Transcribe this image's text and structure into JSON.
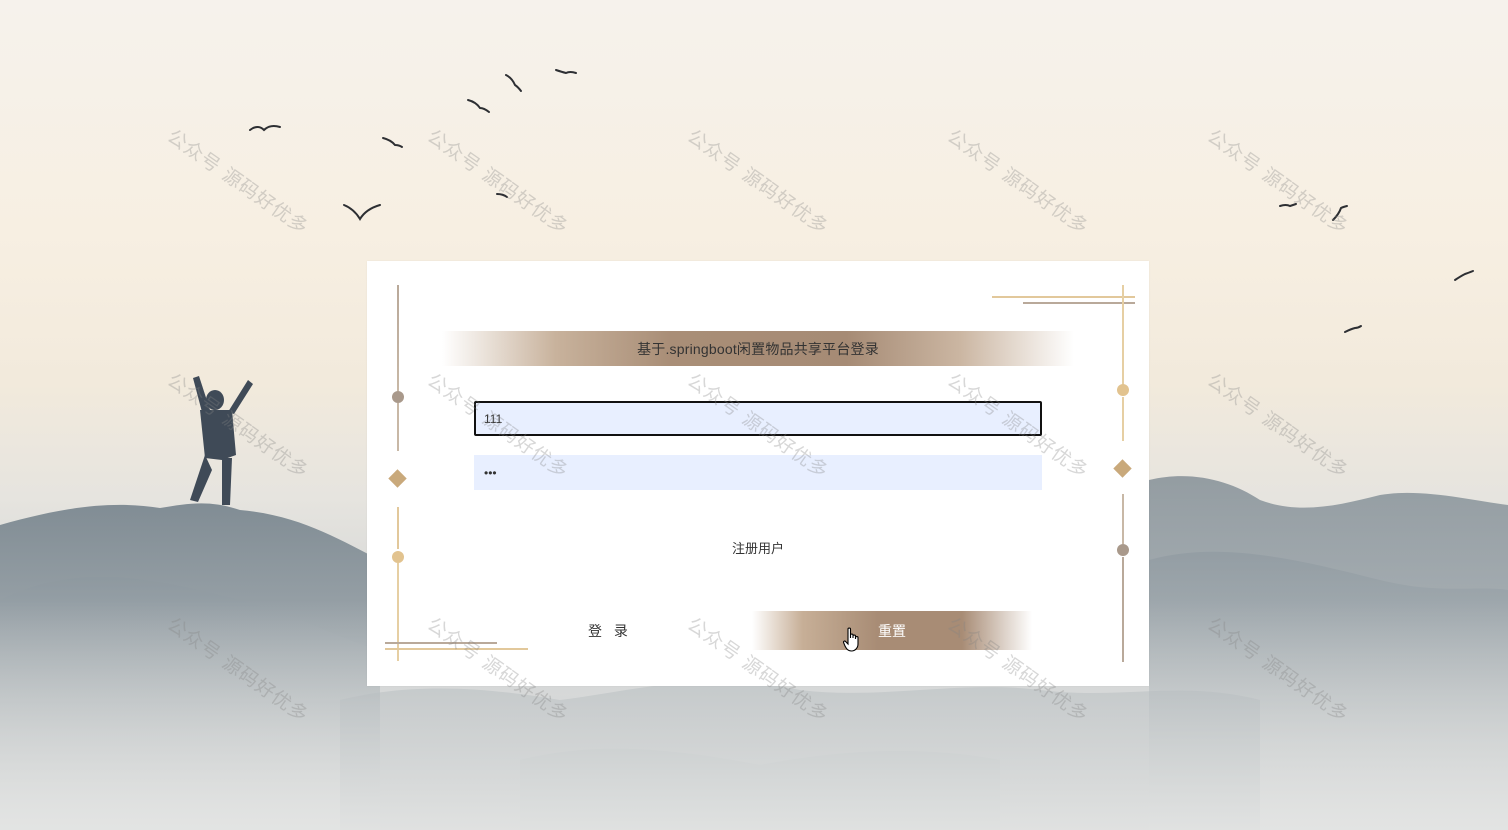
{
  "login": {
    "title": "基于.springboot闲置物品共享平台登录",
    "username_value": "111",
    "password_value": "•••",
    "register_link": "注册用户",
    "login_button": "登 录",
    "reset_button": "重置"
  },
  "watermark": {
    "text": "公众号 源码好优多"
  },
  "colors": {
    "accent_gold": "#c9a97b",
    "accent_brown": "#a88c75",
    "input_bg": "#e8efff"
  }
}
